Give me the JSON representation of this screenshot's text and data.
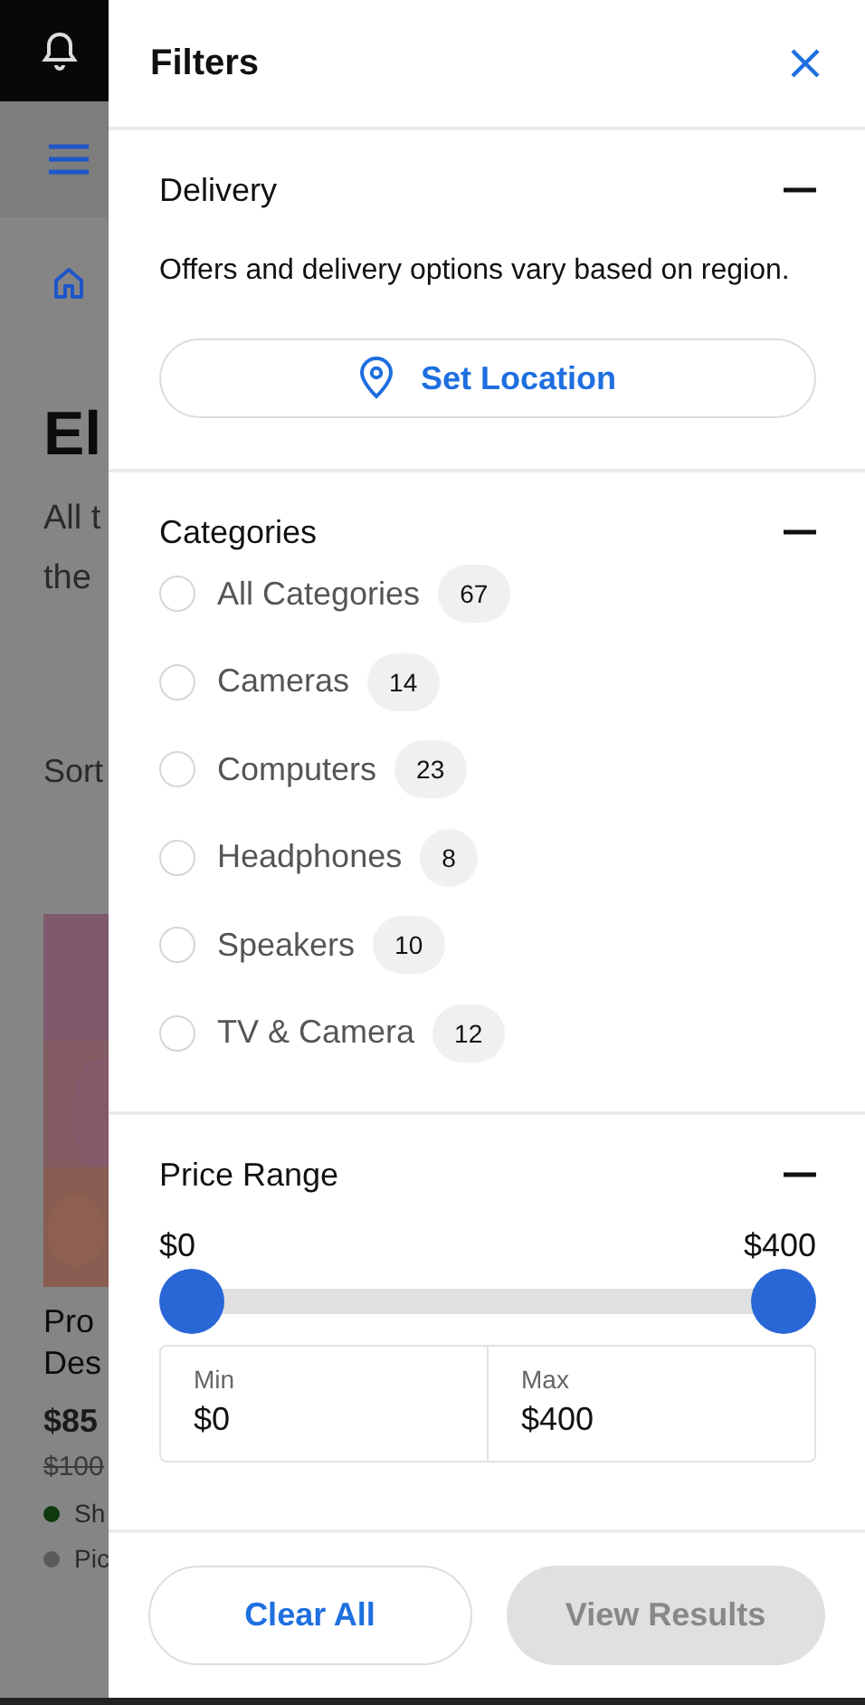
{
  "page": {
    "heading": "El",
    "intro_lines": [
      "All t",
      "the"
    ],
    "sort_label": "Sort",
    "product": {
      "name_lines": [
        "Pro",
        "Des"
      ],
      "price": "$85",
      "old_price": "$100",
      "availability": [
        {
          "label": "Sh",
          "color": "#0f3a0f"
        },
        {
          "label": "Pic",
          "color": "#5a5a5a"
        }
      ]
    }
  },
  "drawer": {
    "title": "Filters",
    "delivery": {
      "title": "Delivery",
      "expanded": true,
      "note": "Offers and delivery options vary based on region.",
      "button": "Set Location"
    },
    "categories": {
      "title": "Categories",
      "expanded": true,
      "items": [
        {
          "label": "All Categories",
          "count": "67",
          "checked": false
        },
        {
          "label": "Cameras",
          "count": "14",
          "checked": false
        },
        {
          "label": "Computers",
          "count": "23",
          "checked": false
        },
        {
          "label": "Headphones",
          "count": "8",
          "checked": false
        },
        {
          "label": "Speakers",
          "count": "10",
          "checked": false
        },
        {
          "label": "TV & Camera",
          "count": "12",
          "checked": false
        }
      ]
    },
    "price": {
      "title": "Price Range",
      "expanded": true,
      "low_label": "$0",
      "high_label": "$400",
      "thumbs": [
        {
          "level": 0
        },
        {
          "level": 1
        }
      ],
      "fields": [
        {
          "label": "Min",
          "value": "$0"
        },
        {
          "label": "Max",
          "value": "$400"
        }
      ]
    },
    "buttons": {
      "clear": "Clear All",
      "view": "View Results",
      "view_disabled": true
    }
  }
}
